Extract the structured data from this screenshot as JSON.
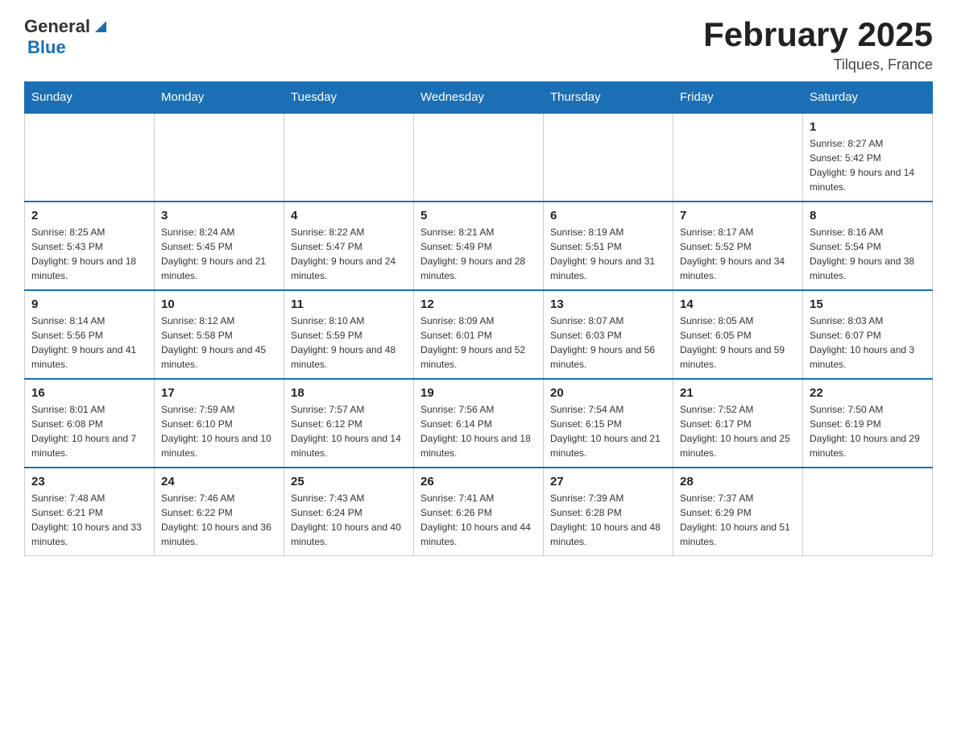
{
  "header": {
    "logo_general": "General",
    "logo_blue": "Blue",
    "month_title": "February 2025",
    "location": "Tilques, France"
  },
  "days_of_week": [
    "Sunday",
    "Monday",
    "Tuesday",
    "Wednesday",
    "Thursday",
    "Friday",
    "Saturday"
  ],
  "weeks": [
    [
      {
        "day": "",
        "info": ""
      },
      {
        "day": "",
        "info": ""
      },
      {
        "day": "",
        "info": ""
      },
      {
        "day": "",
        "info": ""
      },
      {
        "day": "",
        "info": ""
      },
      {
        "day": "",
        "info": ""
      },
      {
        "day": "1",
        "info": "Sunrise: 8:27 AM\nSunset: 5:42 PM\nDaylight: 9 hours and 14 minutes."
      }
    ],
    [
      {
        "day": "2",
        "info": "Sunrise: 8:25 AM\nSunset: 5:43 PM\nDaylight: 9 hours and 18 minutes."
      },
      {
        "day": "3",
        "info": "Sunrise: 8:24 AM\nSunset: 5:45 PM\nDaylight: 9 hours and 21 minutes."
      },
      {
        "day": "4",
        "info": "Sunrise: 8:22 AM\nSunset: 5:47 PM\nDaylight: 9 hours and 24 minutes."
      },
      {
        "day": "5",
        "info": "Sunrise: 8:21 AM\nSunset: 5:49 PM\nDaylight: 9 hours and 28 minutes."
      },
      {
        "day": "6",
        "info": "Sunrise: 8:19 AM\nSunset: 5:51 PM\nDaylight: 9 hours and 31 minutes."
      },
      {
        "day": "7",
        "info": "Sunrise: 8:17 AM\nSunset: 5:52 PM\nDaylight: 9 hours and 34 minutes."
      },
      {
        "day": "8",
        "info": "Sunrise: 8:16 AM\nSunset: 5:54 PM\nDaylight: 9 hours and 38 minutes."
      }
    ],
    [
      {
        "day": "9",
        "info": "Sunrise: 8:14 AM\nSunset: 5:56 PM\nDaylight: 9 hours and 41 minutes."
      },
      {
        "day": "10",
        "info": "Sunrise: 8:12 AM\nSunset: 5:58 PM\nDaylight: 9 hours and 45 minutes."
      },
      {
        "day": "11",
        "info": "Sunrise: 8:10 AM\nSunset: 5:59 PM\nDaylight: 9 hours and 48 minutes."
      },
      {
        "day": "12",
        "info": "Sunrise: 8:09 AM\nSunset: 6:01 PM\nDaylight: 9 hours and 52 minutes."
      },
      {
        "day": "13",
        "info": "Sunrise: 8:07 AM\nSunset: 6:03 PM\nDaylight: 9 hours and 56 minutes."
      },
      {
        "day": "14",
        "info": "Sunrise: 8:05 AM\nSunset: 6:05 PM\nDaylight: 9 hours and 59 minutes."
      },
      {
        "day": "15",
        "info": "Sunrise: 8:03 AM\nSunset: 6:07 PM\nDaylight: 10 hours and 3 minutes."
      }
    ],
    [
      {
        "day": "16",
        "info": "Sunrise: 8:01 AM\nSunset: 6:08 PM\nDaylight: 10 hours and 7 minutes."
      },
      {
        "day": "17",
        "info": "Sunrise: 7:59 AM\nSunset: 6:10 PM\nDaylight: 10 hours and 10 minutes."
      },
      {
        "day": "18",
        "info": "Sunrise: 7:57 AM\nSunset: 6:12 PM\nDaylight: 10 hours and 14 minutes."
      },
      {
        "day": "19",
        "info": "Sunrise: 7:56 AM\nSunset: 6:14 PM\nDaylight: 10 hours and 18 minutes."
      },
      {
        "day": "20",
        "info": "Sunrise: 7:54 AM\nSunset: 6:15 PM\nDaylight: 10 hours and 21 minutes."
      },
      {
        "day": "21",
        "info": "Sunrise: 7:52 AM\nSunset: 6:17 PM\nDaylight: 10 hours and 25 minutes."
      },
      {
        "day": "22",
        "info": "Sunrise: 7:50 AM\nSunset: 6:19 PM\nDaylight: 10 hours and 29 minutes."
      }
    ],
    [
      {
        "day": "23",
        "info": "Sunrise: 7:48 AM\nSunset: 6:21 PM\nDaylight: 10 hours and 33 minutes."
      },
      {
        "day": "24",
        "info": "Sunrise: 7:46 AM\nSunset: 6:22 PM\nDaylight: 10 hours and 36 minutes."
      },
      {
        "day": "25",
        "info": "Sunrise: 7:43 AM\nSunset: 6:24 PM\nDaylight: 10 hours and 40 minutes."
      },
      {
        "day": "26",
        "info": "Sunrise: 7:41 AM\nSunset: 6:26 PM\nDaylight: 10 hours and 44 minutes."
      },
      {
        "day": "27",
        "info": "Sunrise: 7:39 AM\nSunset: 6:28 PM\nDaylight: 10 hours and 48 minutes."
      },
      {
        "day": "28",
        "info": "Sunrise: 7:37 AM\nSunset: 6:29 PM\nDaylight: 10 hours and 51 minutes."
      },
      {
        "day": "",
        "info": ""
      }
    ]
  ]
}
